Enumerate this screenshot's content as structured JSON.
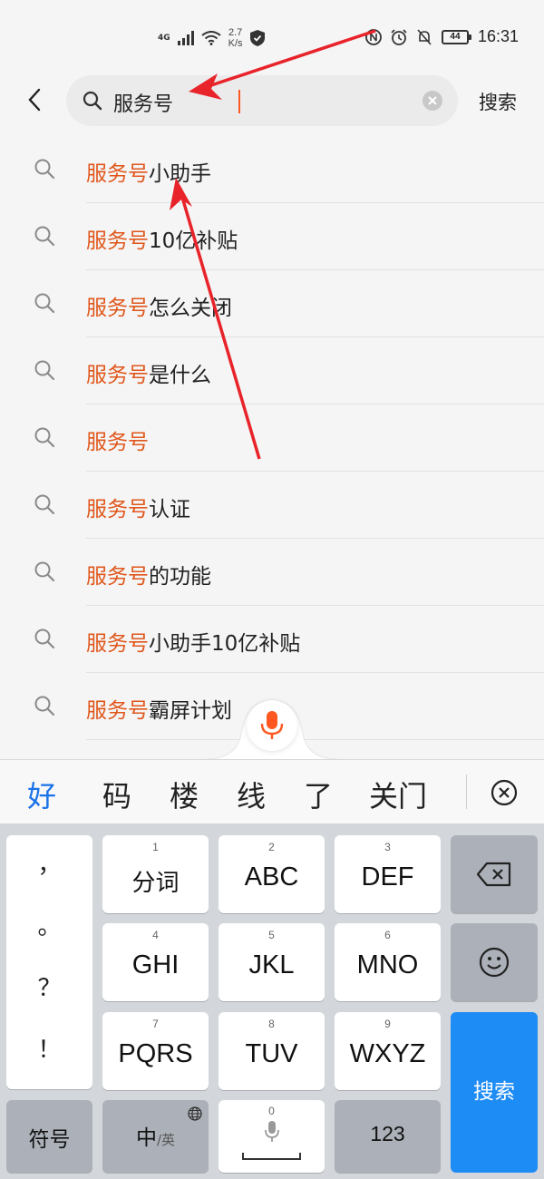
{
  "status_bar": {
    "network": "4G",
    "speed_value": "2.7",
    "speed_unit": "K/s",
    "battery": "44",
    "time": "16:31"
  },
  "search": {
    "back_icon": "chevron-left-icon",
    "query": "服务号",
    "clear_icon": "clear-circle-icon",
    "button_label": "搜索"
  },
  "suggestions": [
    {
      "highlight": "服务号",
      "rest": "小助手"
    },
    {
      "highlight": "服务号",
      "rest": "10亿补贴"
    },
    {
      "highlight": "服务号",
      "rest": "怎么关闭"
    },
    {
      "highlight": "服务号",
      "rest": "是什么"
    },
    {
      "highlight": "服务号",
      "rest": ""
    },
    {
      "highlight": "服务号",
      "rest": "认证"
    },
    {
      "highlight": "服务号",
      "rest": "的功能"
    },
    {
      "highlight": "服务号",
      "rest": "小助手10亿补贴"
    },
    {
      "highlight": "服务号",
      "rest": "霸屏计划"
    }
  ],
  "colors": {
    "highlight": "#e0561b",
    "accent_blue": "#1a73e8",
    "search_key": "#1e8cf5",
    "mic": "#ff5722",
    "annotation_arrow": "#e8232a"
  },
  "keyboard": {
    "candidates": [
      "好",
      "码",
      "楼",
      "线",
      "了",
      "关门"
    ],
    "punctuation": [
      "，",
      "。",
      "？",
      "！"
    ],
    "keys": [
      {
        "num": "1",
        "label": "分词"
      },
      {
        "num": "2",
        "label": "ABC"
      },
      {
        "num": "3",
        "label": "DEF"
      },
      {
        "num": "4",
        "label": "GHI"
      },
      {
        "num": "5",
        "label": "JKL"
      },
      {
        "num": "6",
        "label": "MNO"
      },
      {
        "num": "7",
        "label": "PQRS"
      },
      {
        "num": "8",
        "label": "TUV"
      },
      {
        "num": "9",
        "label": "WXYZ"
      }
    ],
    "symbols_label": "符号",
    "lang_main": "中",
    "lang_alt": "/英",
    "space_num": "0",
    "numbers_label": "123",
    "search_label": "搜索"
  }
}
